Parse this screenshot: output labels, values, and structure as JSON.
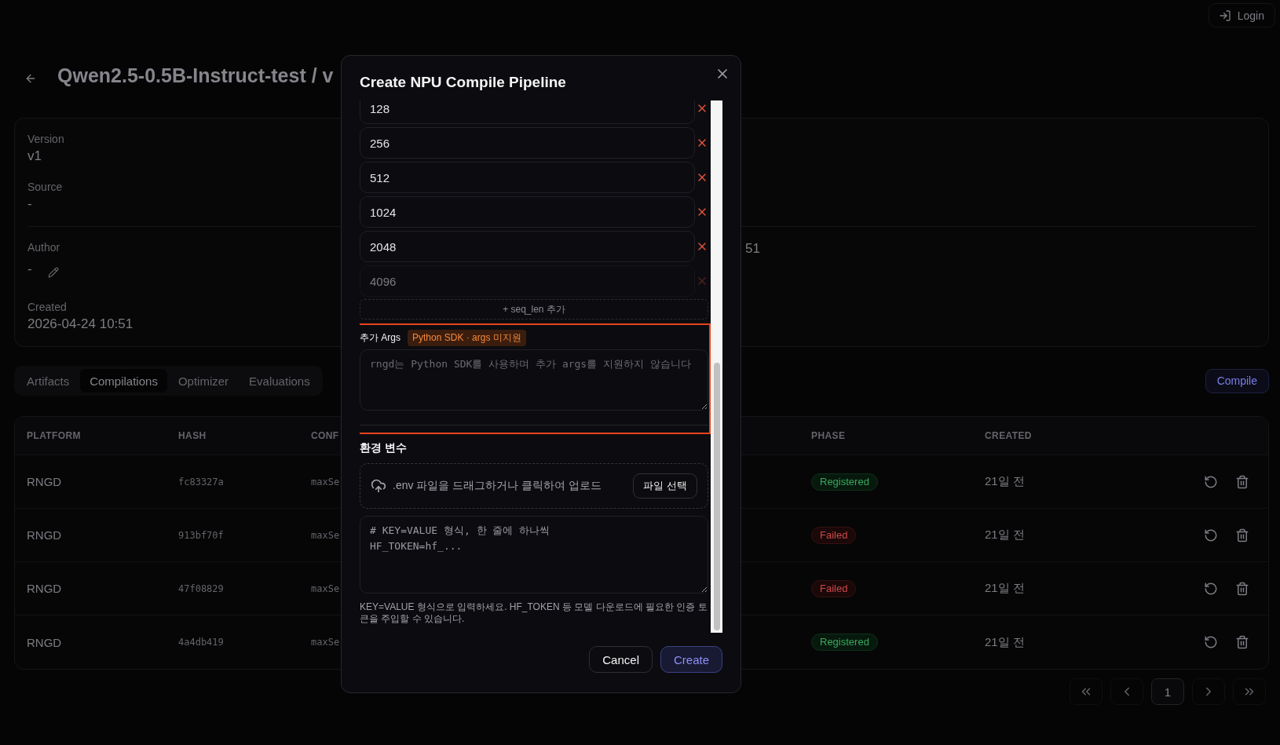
{
  "top_bar": {
    "login_button": "Login"
  },
  "title": "Qwen2.5-0.5B-Instruct-test / v",
  "details": {
    "sections": [
      {
        "fields": [
          {
            "label": "Version",
            "value": "v1",
            "kind": "text"
          },
          {
            "label": "Source",
            "value": "-",
            "kind": "text"
          }
        ]
      },
      {
        "fields": [
          {
            "label": "Author",
            "value": "-",
            "kind": "editable"
          },
          {
            "label": "Created",
            "value": "2026-04-24 10:51",
            "kind": "text"
          }
        ],
        "column_2_value": "51"
      }
    ]
  },
  "tabs": [
    {
      "label": "Artifacts",
      "selected": false
    },
    {
      "label": "Compilations",
      "selected": true
    },
    {
      "label": "Optimizer",
      "selected": false
    },
    {
      "label": "Evaluations",
      "selected": false
    }
  ],
  "compile_button": "Compile",
  "table": {
    "columns": [
      {
        "label": "PLATFORM"
      },
      {
        "label": "HASH"
      },
      {
        "label": "CONF"
      },
      {
        "label": "PHASE"
      },
      {
        "label": "CREATED"
      }
    ],
    "rows": [
      {
        "platform": "RNGD",
        "hash": "fc83327a",
        "column_3": "maxSe",
        "phase": {
          "label": "Registered",
          "kind": "success"
        },
        "created": "21일 전"
      },
      {
        "platform": "RNGD",
        "hash": "913bf70f",
        "column_3": "maxSe",
        "phase": {
          "label": "Failed",
          "kind": "error"
        },
        "created": "21일 전"
      },
      {
        "platform": "RNGD",
        "hash": "47f08829",
        "column_3": "maxSe",
        "phase": {
          "label": "Failed",
          "kind": "error"
        },
        "created": "21일 전"
      },
      {
        "platform": "RNGD",
        "hash": "4a4db419",
        "column_3": "maxSe",
        "phase": {
          "label": "Registered",
          "kind": "success"
        },
        "created": "21일 전"
      }
    ]
  },
  "pagination": {
    "pages": [
      {
        "label": "1",
        "selected": true
      }
    ]
  },
  "dialog": {
    "title": "Create NPU Compile Pipeline",
    "seq_lens": [
      {
        "value": "128",
        "disabled": false
      },
      {
        "value": "256",
        "disabled": false
      },
      {
        "value": "512",
        "disabled": false
      },
      {
        "value": "1024",
        "disabled": false
      },
      {
        "value": "2048",
        "disabled": false
      },
      {
        "value": "4096",
        "disabled": true
      }
    ],
    "add_seq_len_button": "+ seq_len 추가",
    "extra_args": {
      "label": "추가 Args",
      "badge": "Python SDK · args 미지원",
      "placeholder": "rngd는 Python SDK를 사용하며 추가 args를 지원하지 않습니다",
      "disabled": true,
      "highlighted": true
    },
    "env": {
      "label": "환경 변수",
      "dropzone_text": ".env 파일을 드래그하거나 클릭하여 업로드",
      "file_button": "파일 선택",
      "placeholder": "# KEY=VALUE 형식, 한 줄에 하나씩\nHF_TOKEN=hf_...",
      "help": "KEY=VALUE 형식으로 입력하세요. HF_TOKEN 등 모델 다운로드에 필요한 인증 토큰을 주입할 수 있습니다."
    },
    "buttons": [
      {
        "label": "Cancel",
        "kind": "secondary"
      },
      {
        "label": "Create",
        "kind": "primary"
      }
    ]
  }
}
